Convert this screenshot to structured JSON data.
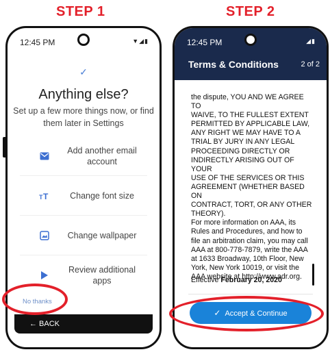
{
  "steps": {
    "step1_label": "STEP 1",
    "step2_label": "STEP 2"
  },
  "accent_color": "#e3202a",
  "phone1": {
    "time": "12:45 PM",
    "status_icons": "▼◢▮",
    "check": "✓",
    "heading": "Anything else?",
    "subtitle": "Set up a few more things now, or find them later in Settings",
    "options": [
      {
        "label": "Add another email account",
        "icon": "email-icon"
      },
      {
        "label": "Change font size",
        "icon": "font-size-icon"
      },
      {
        "label": "Change wallpaper",
        "icon": "wallpaper-icon"
      },
      {
        "label": "Review additional apps",
        "icon": "play-store-icon"
      }
    ],
    "no_thanks": "No thanks",
    "back": "← BACK"
  },
  "phone2": {
    "time": "12:45 PM",
    "status_icons": "◢▮",
    "title": "Terms & Conditions",
    "page": "2 of 2",
    "terms_lines": [
      "the dispute, YOU AND WE AGREE TO",
      "WAIVE, TO THE FULLEST EXTENT",
      "PERMITTED BY APPLICABLE LAW,",
      "ANY RIGHT WE MAY HAVE TO A",
      "TRIAL BY JURY IN ANY LEGAL",
      "PROCEEDING DIRECTLY OR",
      "INDIRECTLY ARISING OUT OF YOUR",
      "USE OF THE SERVICES OR THIS",
      "AGREEMENT (WHETHER BASED ON",
      "CONTRACT, TORT, OR ANY OTHER",
      "THEORY).",
      "For more information on AAA, its",
      "Rules and Procedures, and how to",
      "file an arbitration claim, you may call",
      "AAA at 800-778-7879, write the AAA",
      "at 1633 Broadway, 10th Floor, New",
      "York, New York 10019, or visit the",
      "AAA website at http://www.adr.org."
    ],
    "effective_label": "Effective",
    "effective_date": "February 20, 2020",
    "accept": "Accept & Continue"
  }
}
